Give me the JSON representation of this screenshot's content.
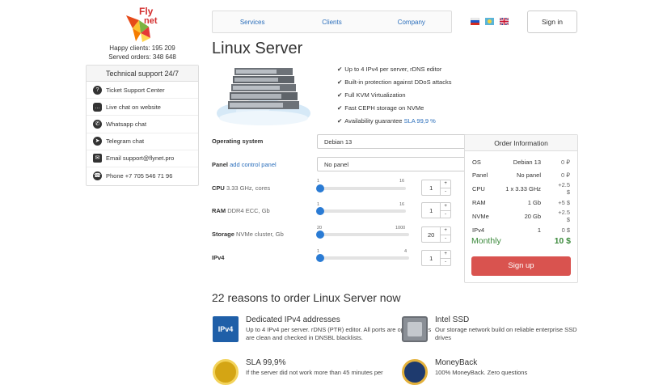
{
  "brand": {
    "logo_top": "Fly",
    "logo_bottom": "net"
  },
  "stats": {
    "happy_clients": "Happy clients: 195 209",
    "served_orders": "Served orders: 348 648"
  },
  "support": {
    "title": "Technical support 24/7",
    "items": [
      {
        "icon": "question-icon",
        "label": "Ticket Support Center"
      },
      {
        "icon": "chat-icon",
        "label": "Live chat on website"
      },
      {
        "icon": "whatsapp-icon",
        "label": "Whatsapp chat"
      },
      {
        "icon": "telegram-icon",
        "label": "Telegram chat"
      },
      {
        "icon": "mail-icon",
        "label": "Email support@flynet.pro"
      },
      {
        "icon": "phone-icon",
        "label": "Phone +7 705 546 71 96"
      }
    ]
  },
  "nav": {
    "items": [
      "Services",
      "Clients",
      "Company"
    ],
    "sign_in": "Sign in"
  },
  "languages": [
    "ru",
    "kz",
    "en"
  ],
  "page": {
    "title": "Linux Server"
  },
  "features": [
    "Up to 4 IPv4 per server, rDNS editor",
    "Built-in protection against DDoS attacks",
    "Full KVM Virtualization",
    "Fast CEPH storage on NVMe"
  ],
  "sla": {
    "text": "Availability guarantee",
    "link": "SLA 99,9 %"
  },
  "config": {
    "os": {
      "label": "Operating system",
      "value": "Debian 13"
    },
    "panel": {
      "label": "Panel",
      "link": "add control panel",
      "value": "No panel"
    },
    "cpu": {
      "label": "CPU",
      "sub": "3.33 GHz, cores",
      "min": "1",
      "max": "16",
      "value": "1",
      "level": 0
    },
    "ram": {
      "label": "RAM",
      "sub": "DDR4 ECC, Gb",
      "min": "1",
      "max": "16",
      "value": "1",
      "level": 0
    },
    "storage": {
      "label": "Storage",
      "sub": "NVMe cluster, Gb",
      "min": "20",
      "max": "1000",
      "value": "20",
      "level": 0
    },
    "ipv4": {
      "label": "IPv4",
      "min": "1",
      "max": "4",
      "value": "1",
      "level": 0
    }
  },
  "order": {
    "title": "Order Information",
    "rows": [
      {
        "k": "OS",
        "v": "Debian 13",
        "p": "0 ₽"
      },
      {
        "k": "Panel",
        "v": "No panel",
        "p": "0 ₽"
      },
      {
        "k": "CPU",
        "v": "1 x 3.33 GHz",
        "p": "+2.5 $"
      },
      {
        "k": "RAM",
        "v": "1 Gb",
        "p": "+5 $"
      },
      {
        "k": "NVMe",
        "v": "20 Gb",
        "p": "+2.5 $"
      },
      {
        "k": "IPv4",
        "v": "1",
        "p": "0 $"
      }
    ],
    "monthly_label": "Monthly",
    "total": "10 $",
    "signup": "Sign up"
  },
  "reasons": {
    "title": "22 reasons to order Linux Server now",
    "items": [
      {
        "icon": "ipv4-icon",
        "icon_text": "IPv4",
        "title": "Dedicated IPv4 addresses",
        "desc": "Up to 4 IPv4 per server. rDNS (PTR) editor. All ports are open. All IPs are clean and checked in DNSBL blacklists."
      },
      {
        "icon": "ssd-icon",
        "title": "Intel SSD",
        "desc": "Our storage network build on reliable enterprise SSD drives"
      },
      {
        "icon": "sla-badge-icon",
        "title": "SLA 99,9%",
        "desc": "If the server did not work more than 45 minutes per"
      },
      {
        "icon": "moneyback-badge-icon",
        "title": "MoneyBack",
        "desc": "100% MoneyBack. Zero questions"
      }
    ]
  },
  "colors": {
    "link": "#2a6ebb",
    "slider": "#2a7bd4",
    "signup": "#d9534f",
    "total": "#3c8a3c"
  }
}
